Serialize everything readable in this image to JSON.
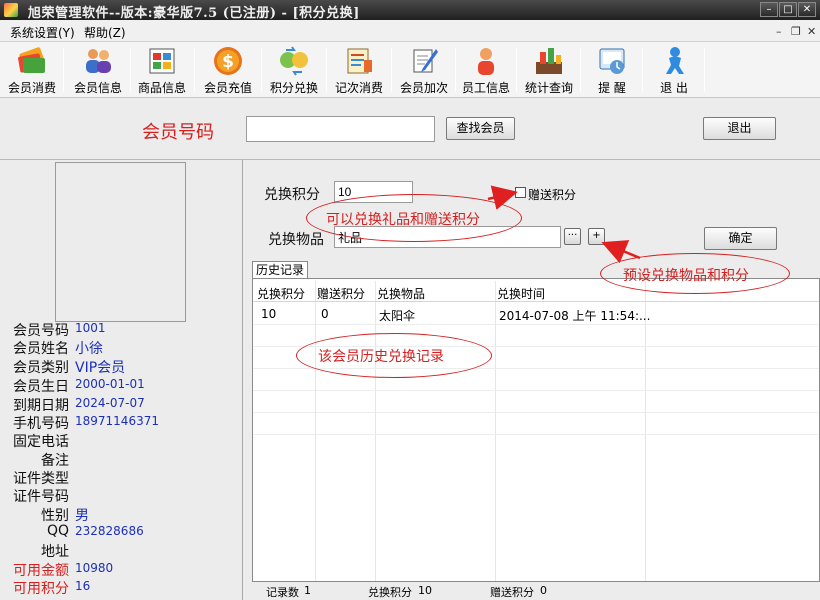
{
  "window": {
    "title": "旭荣管理软件--版本:豪华版7.5 (已注册) - [积分兑换]",
    "min_glyph": "–",
    "max_glyph": "□",
    "close_glyph": "✕"
  },
  "menu": {
    "items": [
      "系统设置(Y)",
      "帮助(Z)"
    ],
    "mdi": [
      "–",
      "❐",
      "✕"
    ]
  },
  "toolbar": {
    "buttons": [
      {
        "label": "会员消费",
        "icon": "card-icon"
      },
      {
        "label": "会员信息",
        "icon": "people-icon"
      },
      {
        "label": "商品信息",
        "icon": "goods-icon"
      },
      {
        "label": "会员充值",
        "icon": "dollar-coin-icon"
      },
      {
        "label": "积分兑换",
        "icon": "points-exchange-icon"
      },
      {
        "label": "记次消费",
        "icon": "notebook-icon"
      },
      {
        "label": "会员加次",
        "icon": "pen-edit-icon"
      },
      {
        "label": "员工信息",
        "icon": "staff-icon"
      },
      {
        "label": "统计查询",
        "icon": "statistics-icon"
      },
      {
        "label": "提  醒",
        "icon": "reminder-icon"
      },
      {
        "label": "退  出",
        "icon": "exit-icon"
      }
    ]
  },
  "search": {
    "label": "会员号码",
    "value": "",
    "find_button": "查找会员",
    "exit_button": "退出"
  },
  "member": {
    "fields": [
      {
        "label": "会员号码",
        "value": "1001",
        "red": false,
        "big": false
      },
      {
        "label": "会员姓名",
        "value": "小徐",
        "red": false,
        "big": true
      },
      {
        "label": "会员类别",
        "value": "VIP会员",
        "red": false,
        "big": true
      },
      {
        "label": "会员生日",
        "value": "2000-01-01",
        "red": false,
        "big": false
      },
      {
        "label": "到期日期",
        "value": "2024-07-07",
        "red": false,
        "big": false
      },
      {
        "label": "手机号码",
        "value": "18971146371",
        "red": false,
        "big": false
      },
      {
        "label": "固定电话",
        "value": "",
        "red": false,
        "big": false
      },
      {
        "label": "备注",
        "value": "",
        "red": false,
        "big": false
      },
      {
        "label": "证件类型",
        "value": "",
        "red": false,
        "big": false
      },
      {
        "label": "证件号码",
        "value": "",
        "red": false,
        "big": false
      },
      {
        "label": "性别",
        "value": "男",
        "red": false,
        "big": true
      },
      {
        "label": "QQ",
        "value": "232828686",
        "red": false,
        "big": false
      },
      {
        "label": "地址",
        "value": "",
        "red": false,
        "big": false
      },
      {
        "label": "可用金额",
        "value": "10980",
        "red": true,
        "big": false
      },
      {
        "label": "可用积分",
        "value": "16",
        "red": true,
        "big": false
      }
    ]
  },
  "exchange": {
    "points_label": "兑换积分",
    "points_value": "10",
    "gift_points_label": "赠送积分",
    "gift_points_checked": false,
    "item_label": "兑换物品",
    "item_value": "礼品",
    "browse_button": "···",
    "add_button": "+",
    "confirm_button": "确定"
  },
  "history": {
    "tab_label": "历史记录",
    "columns": [
      "兑换积分",
      "赠送积分",
      "兑换物品",
      "兑换时间"
    ],
    "rows": [
      [
        "10",
        "0",
        "太阳伞",
        "2014-07-08 上午 11:54:..."
      ]
    ]
  },
  "status": {
    "count_label": "记录数",
    "count_value": "1",
    "points_label": "兑换积分",
    "points_value": "10",
    "gift_label": "赠送积分",
    "gift_value": "0"
  },
  "annotations": {
    "exchange_gift": "可以兑换礼品和赠送积分",
    "preset": "预设兑换物品和积分",
    "history": "该会员历史兑换记录"
  },
  "colors": {
    "label_red": "#d81e1e",
    "value_blue": "#1c2fb8",
    "annotation_red": "#d42020"
  }
}
